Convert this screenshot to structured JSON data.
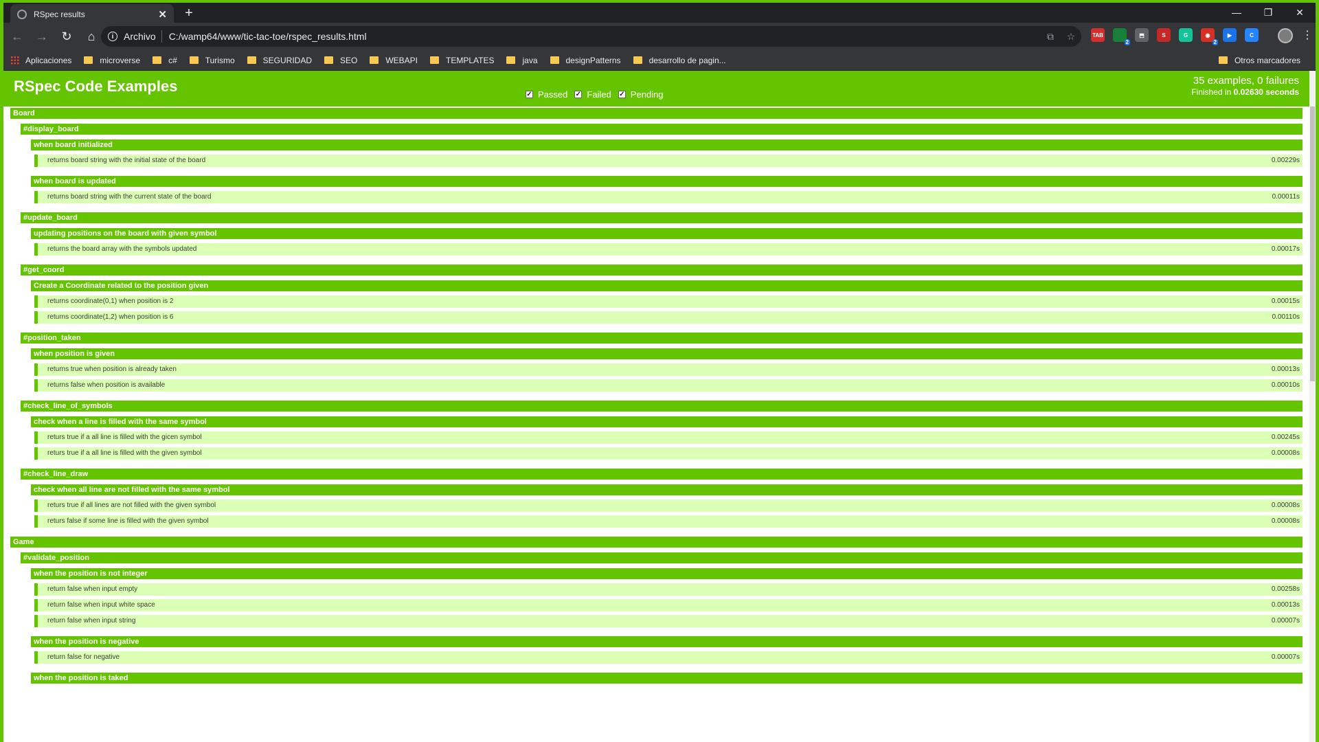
{
  "browser": {
    "tab_title": "RSpec results",
    "address_scheme": "Archivo",
    "address_url": "C:/wamp64/www/tic-tac-toe/rspec_results.html",
    "bookmarks": [
      "Aplicaciones",
      "microverse",
      "c#",
      "Turismo",
      "SEGURIDAD",
      "SEO",
      "WEBAPI",
      "TEMPLATES",
      "java",
      "designPatterns",
      "desarrollo de pagin..."
    ],
    "other_bookmarks": "Otros marcadores",
    "extensions": [
      {
        "name": "tab-icon",
        "label": "TAB",
        "color": "#d32f2f"
      },
      {
        "name": "status-icon",
        "label": "",
        "color": "#188038",
        "badge": "2"
      },
      {
        "name": "pdf-icon",
        "label": "⬒",
        "color": "#5f6368"
      },
      {
        "name": "s-icon",
        "label": "S",
        "color": "#c62828"
      },
      {
        "name": "grammarly-icon",
        "label": "G",
        "color": "#15c39a"
      },
      {
        "name": "notify-icon",
        "label": "◉",
        "color": "#d93025",
        "badge": "2"
      },
      {
        "name": "meet-icon",
        "label": "▶",
        "color": "#1a73e8"
      },
      {
        "name": "c-icon",
        "label": "C",
        "color": "#2684ff"
      }
    ]
  },
  "rspec": {
    "title": "RSpec Code Examples",
    "filters": [
      "Passed",
      "Failed",
      "Pending"
    ],
    "totals": "35 examples, 0 failures",
    "duration_prefix": "Finished in ",
    "duration_value": "0.02630 seconds",
    "sections": [
      {
        "level": 0,
        "label": "Board"
      },
      {
        "level": 1,
        "label": "#display_board"
      },
      {
        "level": 2,
        "label": "when board initialized"
      },
      {
        "example": "returns board string with the initial state of the board",
        "time": "0.00229s"
      },
      {
        "gap": true
      },
      {
        "level": 2,
        "label": "when board is updated"
      },
      {
        "example": "returns board string with the current state of the board",
        "time": "0.00011s"
      },
      {
        "gap": true
      },
      {
        "level": 1,
        "label": "#update_board"
      },
      {
        "level": 2,
        "label": "updating positions on the board with given symbol"
      },
      {
        "example": "returns the board array with the symbols updated",
        "time": "0.00017s"
      },
      {
        "gap": true
      },
      {
        "level": 1,
        "label": "#get_coord"
      },
      {
        "level": 2,
        "label": "Create a Coordinate related to the position given"
      },
      {
        "example": "returns coordinate(0,1) when position is 2",
        "time": "0.00015s"
      },
      {
        "example": "returns coordinate(1,2) when position is 6",
        "time": "0.00110s"
      },
      {
        "gap": true
      },
      {
        "level": 1,
        "label": "#position_taken"
      },
      {
        "level": 2,
        "label": "when position is given"
      },
      {
        "example": "returns true when position is already taken",
        "time": "0.00013s"
      },
      {
        "example": "returns false when position is available",
        "time": "0.00010s"
      },
      {
        "gap": true
      },
      {
        "level": 1,
        "label": "#check_line_of_symbols"
      },
      {
        "level": 2,
        "label": "check when a line is filled with the same symbol"
      },
      {
        "example": "returs true if a all line is filled with the gicen symbol",
        "time": "0.00245s"
      },
      {
        "example": "returs true if a all line is filled with the given symbol",
        "time": "0.00008s"
      },
      {
        "gap": true
      },
      {
        "level": 1,
        "label": "#check_line_draw"
      },
      {
        "level": 2,
        "label": "check when all line are not filled with the same symbol"
      },
      {
        "example": "returs true if all lines are not filled with the given symbol",
        "time": "0.00008s"
      },
      {
        "example": "returs false if some line is filled with the given symbol",
        "time": "0.00008s"
      },
      {
        "gap": true
      },
      {
        "level": 0,
        "label": "Game"
      },
      {
        "level": 1,
        "label": "#validate_position"
      },
      {
        "level": 2,
        "label": "when the position is not integer"
      },
      {
        "example": "return false when input empty",
        "time": "0.00258s"
      },
      {
        "example": "return false when input white space",
        "time": "0.00013s"
      },
      {
        "example": "return false when input string",
        "time": "0.00007s"
      },
      {
        "gap": true
      },
      {
        "level": 2,
        "label": "when the position is negative"
      },
      {
        "example": "return false for negative",
        "time": "0.00007s"
      },
      {
        "gap": true
      },
      {
        "level": 2,
        "label": "when the position is taked"
      }
    ]
  }
}
